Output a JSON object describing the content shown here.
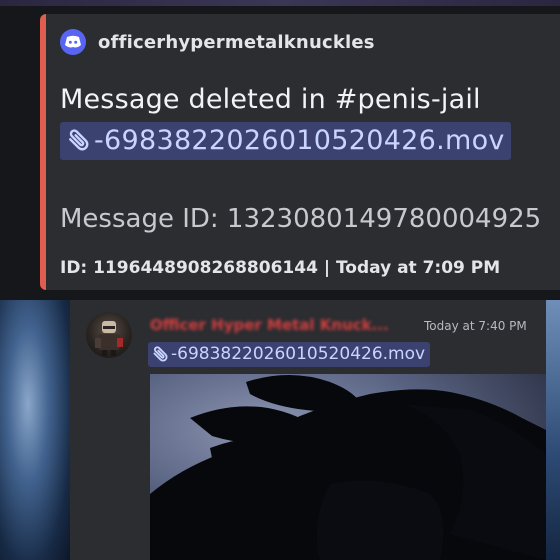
{
  "embed": {
    "author": "officerhypermetalknuckles",
    "title": "Message deleted in #penis-jail",
    "attachment": "-6983822026010520426.mov",
    "message_id": "Message ID: 1323080149780004925",
    "footer": "ID: 1196448908268806144 | Today at 7:09 PM",
    "accent_color": "#e05d4f",
    "author_icon": "discord-logo-icon"
  },
  "message": {
    "username": "Officer Hyper Metal Knuck...",
    "timestamp": "Today at 7:40 PM",
    "attachment": "-6983822026010520426.mov",
    "username_color": "#d13f3f",
    "link_color": "#c9d4ff"
  }
}
